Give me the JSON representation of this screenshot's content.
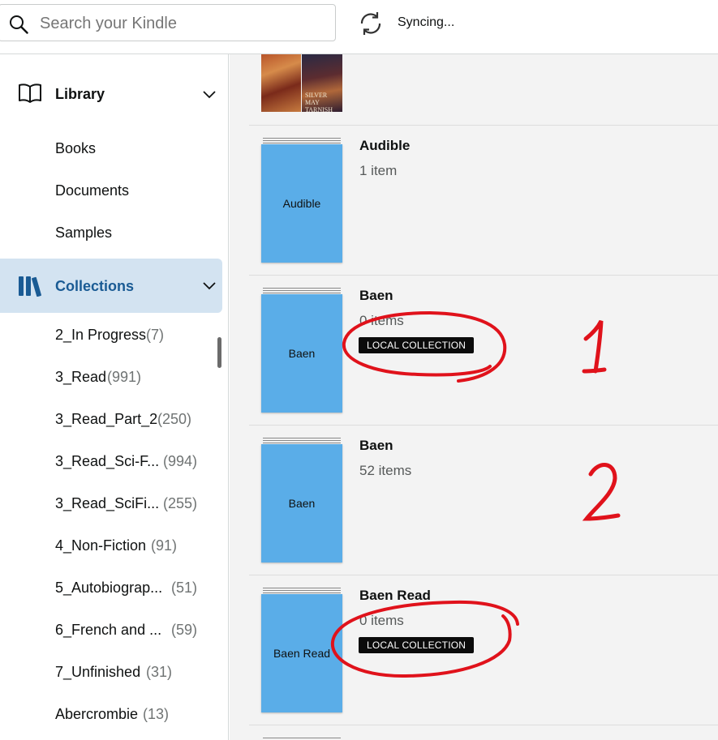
{
  "search": {
    "placeholder": "Search your Kindle",
    "value": ""
  },
  "sync": {
    "status": "Syncing..."
  },
  "sidebar": {
    "library": {
      "label": "Library",
      "items": [
        {
          "label": "Books"
        },
        {
          "label": "Documents"
        },
        {
          "label": "Samples"
        }
      ]
    },
    "collections": {
      "label": "Collections",
      "items": [
        {
          "name": "2_In Progress",
          "count": "(7)"
        },
        {
          "name": "3_Read",
          "count": "(991)"
        },
        {
          "name": "3_Read_Part_2",
          "count": "(250)"
        },
        {
          "name": "3_Read_Sci-F...",
          "count": "(994)"
        },
        {
          "name": "3_Read_SciFi...",
          "count": "(255)"
        },
        {
          "name": "4_Non-Fiction",
          "count": "(91)"
        },
        {
          "name": "5_Autobiograp...",
          "count": "(51)"
        },
        {
          "name": "6_French and ...",
          "count": "(59)"
        },
        {
          "name": "7_Unfinished",
          "count": "(31)"
        },
        {
          "name": "Abercrombie",
          "count": "(13)"
        }
      ]
    }
  },
  "main": {
    "top_cover_text": "SILVER MAY TARNISH",
    "collections": [
      {
        "title": "Audible",
        "count": "1 item",
        "cover_label": "Audible",
        "badge": ""
      },
      {
        "title": "Baen",
        "count": "0 items",
        "cover_label": "Baen",
        "badge": "LOCAL COLLECTION"
      },
      {
        "title": "Baen",
        "count": "52 items",
        "cover_label": "Baen",
        "badge": ""
      },
      {
        "title": "Baen Read",
        "count": "0 items",
        "cover_label": "Baen Read",
        "badge": "LOCAL COLLECTION"
      }
    ]
  },
  "annotations": {
    "number_1": "1",
    "number_2": "2",
    "color": "#e0121b"
  },
  "colors": {
    "accent": "#1a5b94",
    "selected_bg": "#d3e3f1",
    "cover_blue": "#5aade8",
    "badge_bg": "#0b0b0b"
  }
}
